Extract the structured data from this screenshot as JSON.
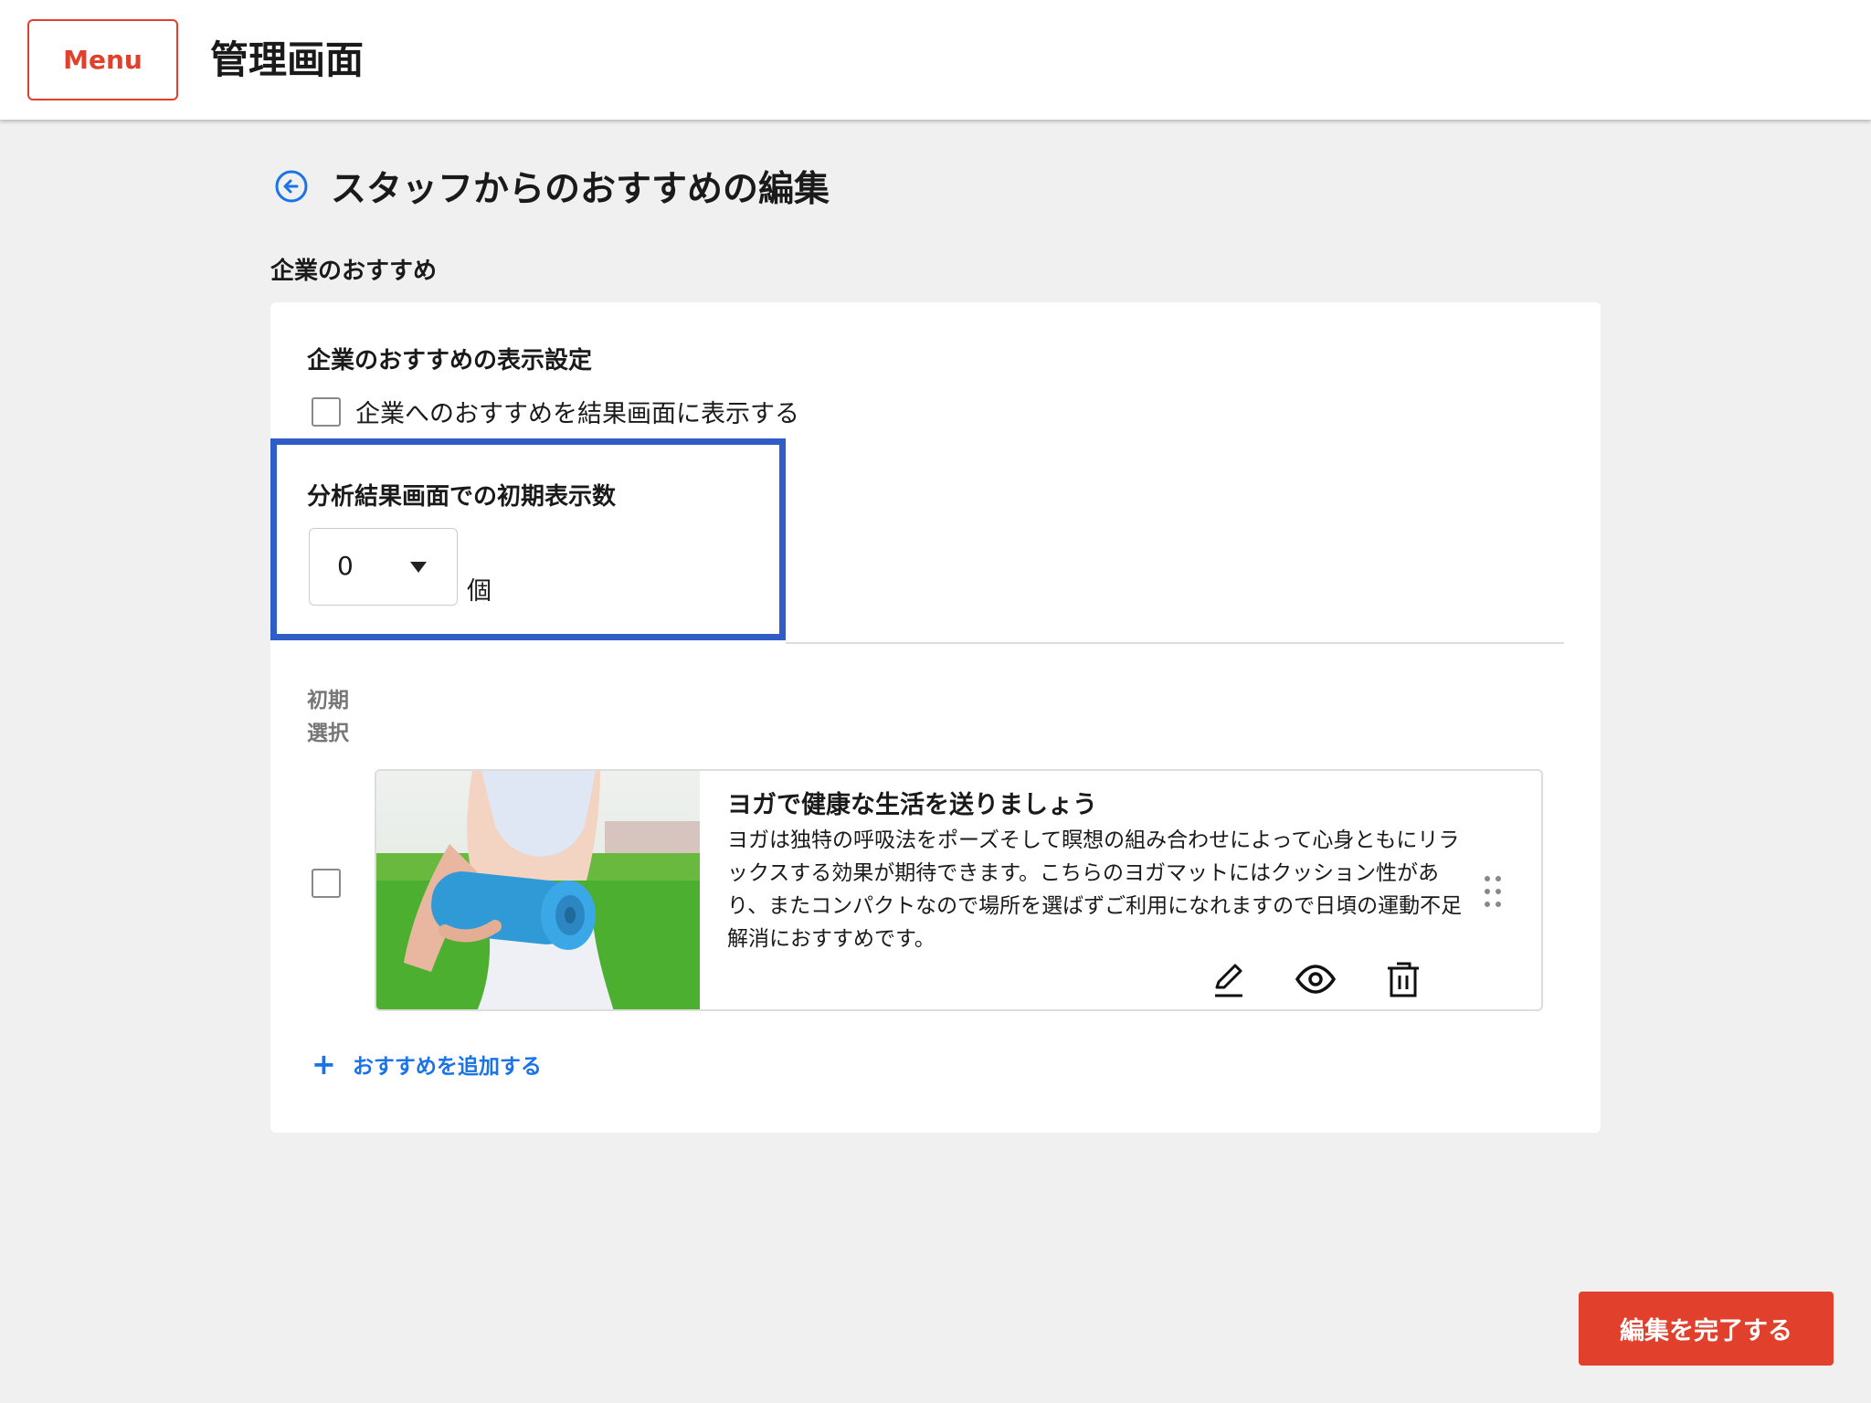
{
  "header": {
    "menu_label": "Menu",
    "app_title": "管理画面"
  },
  "page": {
    "title": "スタッフからのおすすめの編集",
    "section_title": "企業のおすすめ"
  },
  "settings": {
    "display_title": "企業のおすすめの表示設定",
    "display_checkbox_label": "企業へのおすすめを結果画面に表示する",
    "display_checked": false,
    "count_title": "分析結果画面での初期表示数",
    "count_value": "0",
    "count_unit": "個"
  },
  "list": {
    "column_header": "初期選択",
    "items": [
      {
        "checked": false,
        "title": "ヨガで健康な生活を送りましょう",
        "description": "ヨガは独特の呼吸法をポーズそして瞑想の組み合わせによって心身ともにリラックスする効果が期待できます。こちらのヨガマットにはクッション性があり、またコンパクトなので場所を選ばずご利用になれますので日頃の運動不足解消におすすめです。",
        "image": "woman-holding-blue-yoga-mat-photo"
      }
    ],
    "add_label": "おすすめを追加する"
  },
  "footer": {
    "done_label": "編集を完了する"
  },
  "colors": {
    "accent": "#e0402c",
    "link": "#1a73e8",
    "highlight": "#2f5cc7"
  },
  "icons": [
    "back-arrow-icon",
    "edit-pencil-icon",
    "eye-icon",
    "trash-icon",
    "drag-handle-icon",
    "plus-icon",
    "caret-down-icon"
  ]
}
